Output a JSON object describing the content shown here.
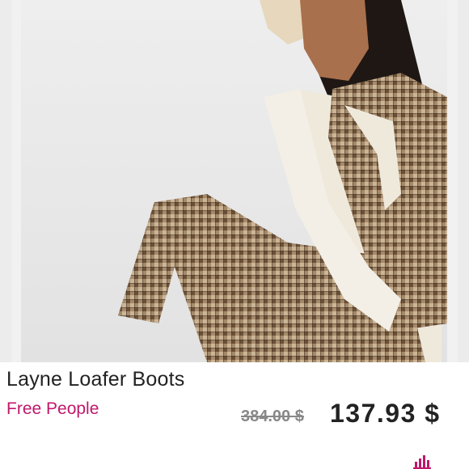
{
  "product": {
    "image_alt": "Model wearing a houndstooth check vest and cropped trousers with a cream knit beanie",
    "title": "Layne Loafer Boots",
    "brand": "Free People",
    "old_price": "384.00 $",
    "price": "137.93 $"
  },
  "colors": {
    "brand": "#c0186b",
    "price": "#222222",
    "old_price": "#888888"
  },
  "icons": {
    "stats": "bar-chart-icon"
  }
}
